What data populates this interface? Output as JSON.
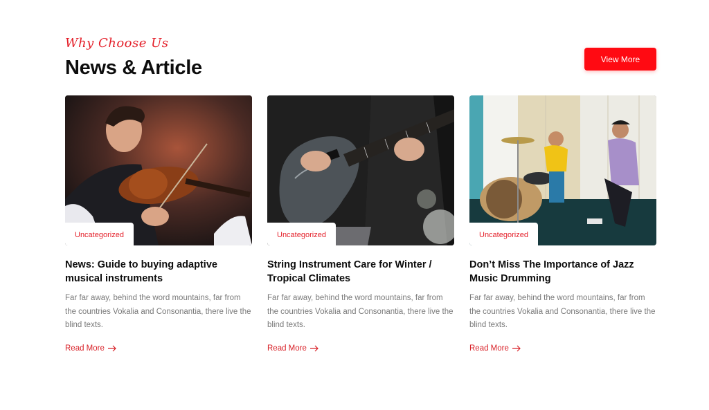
{
  "section": {
    "eyebrow": "Why Choose Us",
    "title": "News & Article",
    "view_more_label": "View More"
  },
  "colors": {
    "accent": "#ff0a12",
    "eyebrow": "#e4202a",
    "excerpt": "#7a7a7a"
  },
  "cards": [
    {
      "image": "violinist-photo",
      "category": "Uncategorized",
      "title": "News: Guide to buying adaptive musical instruments",
      "excerpt": "Far far away, behind the word mountains, far from the countries Vokalia and Consonantia, there live the blind texts.",
      "link": "Read More",
      "link_icon": "arrow-right-icon"
    },
    {
      "image": "electric-guitar-photo",
      "category": "Uncategorized",
      "title": "String Instrument Care for Winter / Tropical Climates",
      "excerpt": "Far far away, behind the word mountains, far from the countries Vokalia and Consonantia, there live the blind texts.",
      "link": "Read More",
      "link_icon": "arrow-right-icon"
    },
    {
      "image": "drum-lesson-photo",
      "category": "Uncategorized",
      "title": "Don’t Miss The Importance of Jazz Music Drumming",
      "excerpt": "Far far away, behind the word mountains, far from the countries Vokalia and Consonantia, there live the blind texts.",
      "link": "Read More",
      "link_icon": "arrow-right-icon"
    }
  ]
}
